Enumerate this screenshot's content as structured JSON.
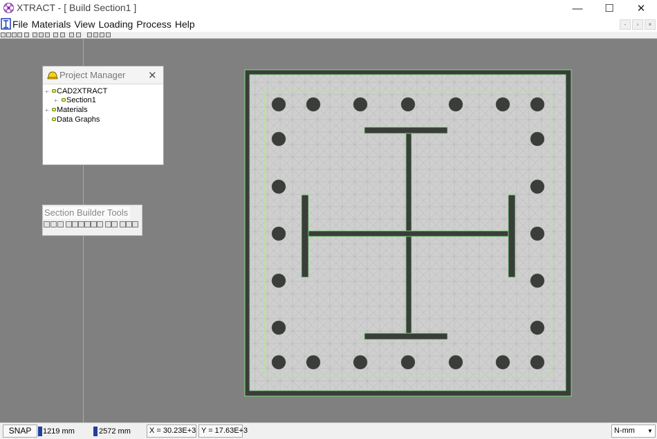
{
  "window": {
    "title": "XTRACT - [ Build Section1 ]",
    "min_glyph": "—",
    "max_glyph": "☐",
    "close_glyph": "✕",
    "icon": "xtract-flower-icon"
  },
  "mdi": {
    "min": "-",
    "restore": "▫",
    "close": "×"
  },
  "menu": {
    "items": [
      "File",
      "Materials",
      "View",
      "Loading",
      "Process",
      "Help"
    ]
  },
  "project_manager": {
    "title": "Project Manager",
    "close_glyph": "✕",
    "tree": [
      {
        "label": "CAD2XTRACT",
        "level": 0
      },
      {
        "label": "Section1",
        "level": 1
      },
      {
        "label": "Materials",
        "level": 0
      },
      {
        "label": "Data Graphs",
        "level": 0
      }
    ]
  },
  "section_builder_tools": {
    "title": "Section Builder Tools"
  },
  "status": {
    "snap": "SNAP",
    "width": "1219 mm",
    "height": "2572 mm",
    "x": "X = 30.23E+3",
    "y": "Y = 17.63E+3",
    "units": "N-mm"
  },
  "colors": {
    "canvas_bg": "#808080",
    "concrete_fill": "#cfcfcf",
    "steel": "#3a3d3a",
    "mesh_line": "#7fe07f",
    "confinement": "#a8f08a"
  }
}
